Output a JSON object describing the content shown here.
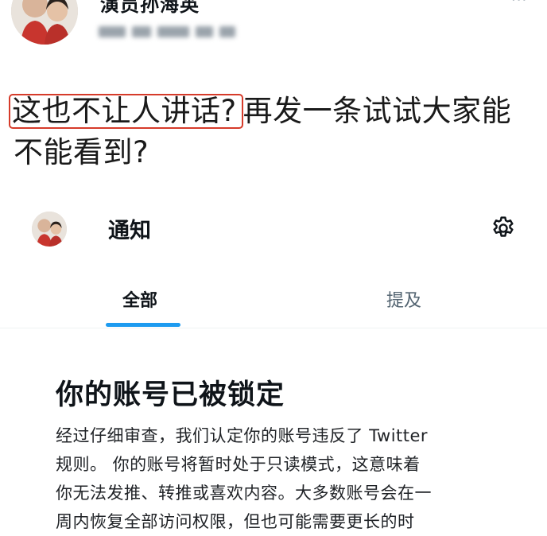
{
  "post": {
    "author_name": "演员孙海英",
    "more_label": "···",
    "text_highlighted": "这也不让人讲话?",
    "text_rest_line1": "再发一条试试大家能",
    "text_line2": "不能看到?"
  },
  "notifications": {
    "title": "通知",
    "tabs": [
      {
        "label": "全部"
      },
      {
        "label": "提及"
      }
    ],
    "accent_color": "#1d9bf0",
    "locked": {
      "heading": "你的账号已被锁定",
      "lines": [
        "经过仔细审查，我们认定你的账号违反了 Twitter",
        "规则。 你的账号将暂时处于只读模式，这意味着",
        "你无法发推、转推或喜欢内容。大多数账号会在一",
        "周内恢复全部访问权限，但也可能需要更长的时"
      ]
    }
  },
  "icons": {
    "settings": "gear-icon",
    "more": "more-icon"
  },
  "highlight_color": "#d63b2a"
}
